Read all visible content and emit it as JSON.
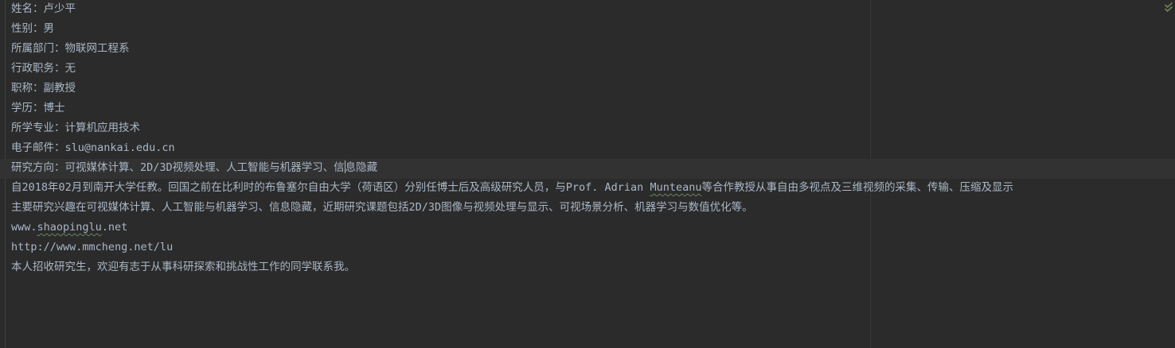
{
  "editor": {
    "lines": [
      {
        "text": "姓名：卢少平"
      },
      {
        "text": "性别：男"
      },
      {
        "text": "所属部门：物联网工程系"
      },
      {
        "text": "行政职务：无"
      },
      {
        "text": "职称：副教授"
      },
      {
        "text": "学历：博士"
      },
      {
        "text": "所学专业：计算机应用技术"
      },
      {
        "text": "电子邮件：slu@nankai.edu.cn"
      },
      {
        "before_caret": "研究方向：可视媒体计算、2D/3D视频处理、人工智能与机器学习、信",
        "after_caret": "息隐藏"
      },
      {
        "before_squiggle": "自2018年02月到南开大学任教。回国之前在比利时的布鲁塞尔自由大学（荷语区）分别任博士后及高级研究人员，与Prof. Adrian ",
        "squiggle": "Munteanu",
        "after_squiggle": "等合作教授从事自由多视点及三维视频的采集、传输、压缩及显示"
      },
      {
        "text": "主要研究兴趣在可视媒体计算、人工智能与机器学习、信息隐藏，近期研究课题包括2D/3D图像与视频处理与显示、可视场景分析、机器学习与数值优化等。"
      },
      {
        "before_squiggle": "www.",
        "squiggle": "shaopinglu",
        "after_squiggle": ".net"
      },
      {
        "text": "http://www.mmcheng.net/lu"
      },
      {
        "text": "本人招收研究生，欢迎有志于从事科研探索和挑战性工作的同学联系我。"
      }
    ]
  },
  "status": {
    "icon": "check-icon",
    "color": "#6a8759"
  }
}
